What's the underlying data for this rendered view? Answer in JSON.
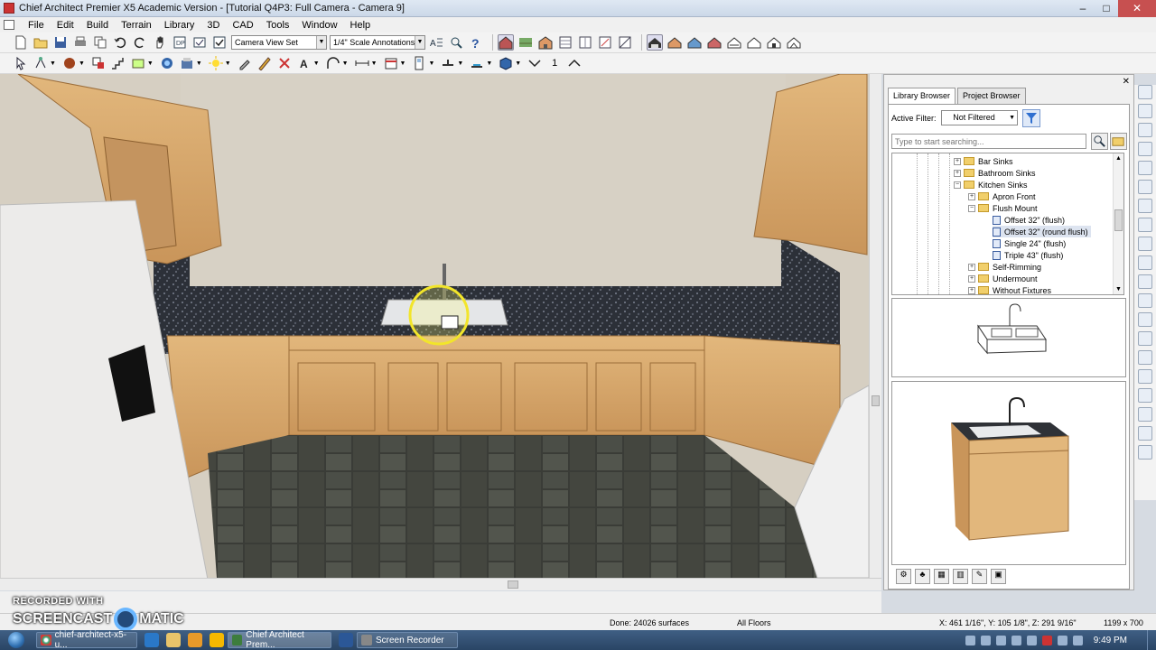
{
  "window": {
    "title": "Chief Architect Premier X5 Academic Version - [Tutorial Q4P3: Full Camera - Camera 9]",
    "min": "–",
    "max": "□",
    "close": "✕"
  },
  "menu": [
    "File",
    "Edit",
    "Build",
    "Terrain",
    "Library",
    "3D",
    "CAD",
    "Tools",
    "Window",
    "Help"
  ],
  "toolbar": {
    "camera_view_set": "Camera View Set",
    "annotation_set": "1/4\" Scale Annotations",
    "number_one": "1"
  },
  "library": {
    "tabs": [
      "Library Browser",
      "Project Browser"
    ],
    "active_filter_label": "Active Filter:",
    "active_filter_value": "Not Filtered",
    "search_placeholder": "Type to start searching...",
    "tree": [
      {
        "label": "Bar Sinks",
        "type": "folder",
        "expander": "+"
      },
      {
        "label": "Bathroom Sinks",
        "type": "folder",
        "expander": "+"
      },
      {
        "label": "Kitchen Sinks",
        "type": "folder",
        "expander": "−"
      },
      {
        "label": "Apron Front",
        "type": "folder",
        "expander": "+"
      },
      {
        "label": "Flush Mount",
        "type": "folder",
        "expander": "−"
      },
      {
        "label": "Offset 32\" (flush)",
        "type": "item",
        "expander": ""
      },
      {
        "label": "Offset 32\" (round flush)",
        "type": "item",
        "expander": "",
        "selected": true
      },
      {
        "label": "Single 24\" (flush)",
        "type": "item",
        "expander": ""
      },
      {
        "label": "Triple 43\" (flush)",
        "type": "item",
        "expander": ""
      },
      {
        "label": "Self-Rimming",
        "type": "folder",
        "expander": "+"
      },
      {
        "label": "Undermount",
        "type": "folder",
        "expander": "+"
      },
      {
        "label": "Without Fixtures",
        "type": "folder",
        "expander": "+"
      }
    ]
  },
  "status": {
    "done": "Done:  24026 surfaces",
    "floors": "All Floors",
    "coords": "X: 461 1/16\", Y: 105 1/8\", Z: 291 9/16\"",
    "size": "1199 x 700"
  },
  "watermark": {
    "line1": "RECORDED WITH",
    "line2a": "SCREENCAST",
    "line2b": "MATIC"
  },
  "taskbar": {
    "tasks": [
      {
        "label": "chief-architect-x5-u...",
        "color": "#e0e0e0"
      },
      {
        "label": "Chief Architect Prem...",
        "color": "#3d7d3d"
      },
      {
        "label": "Screen Recorder",
        "color": "#888"
      }
    ],
    "clock": "9:49 PM"
  }
}
